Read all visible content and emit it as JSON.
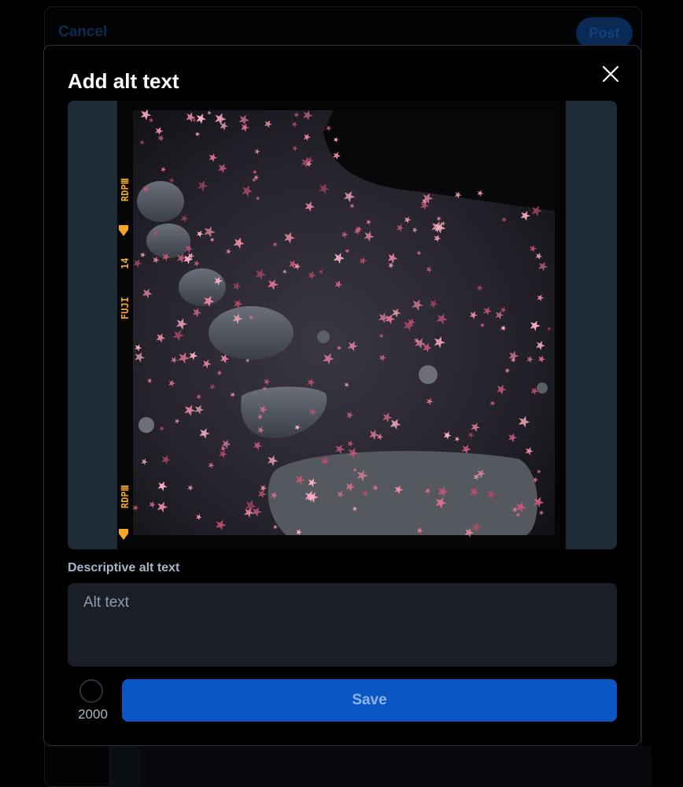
{
  "background": {
    "cancel_label": "Cancel",
    "post_label": "Post"
  },
  "modal": {
    "title": "Add alt text",
    "close_icon": "close-icon",
    "image": {
      "film_edge": {
        "top_code": "RDPⅢ",
        "number": "14",
        "brand": "FUJI",
        "bottom_code": "RDPⅢ"
      }
    },
    "field_label": "Descriptive alt text",
    "input": {
      "placeholder": "Alt text",
      "value": ""
    },
    "char_counter": "2000",
    "save_label": "Save"
  },
  "colors": {
    "accent": "#0b56c5",
    "modal_border": "#2a3340",
    "input_bg": "#1a1f27",
    "image_bg": "#1e2a34",
    "film_edge_text": "#f5a623"
  }
}
